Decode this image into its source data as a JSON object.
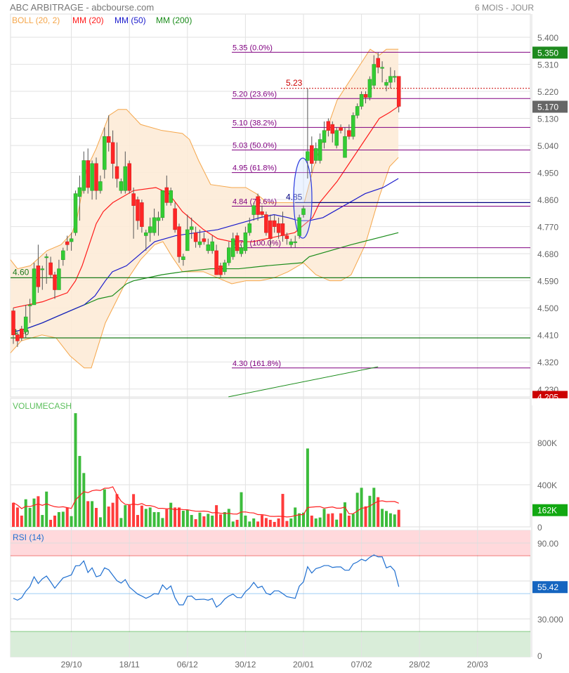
{
  "header": {
    "title": "ABC ARBITRAGE - abcbourse.com",
    "period": "6 MOIS - JOUR"
  },
  "legend": [
    {
      "label": "BOLL (20, 2)",
      "color": "#f5a64a"
    },
    {
      "label": "MM (20)",
      "color": "#ff1a1a"
    },
    {
      "label": "MM (50)",
      "color": "#1a1acc"
    },
    {
      "label": "MM (200)",
      "color": "#1a8c1a"
    }
  ],
  "colors": {
    "up": "#33cc33",
    "down": "#ff2626",
    "fib": "#800080",
    "boll_fill": "#fdebd7",
    "rsi": "#1f6fd0"
  },
  "chart_data": {
    "type": "candlestick",
    "title": "ABC ARBITRAGE",
    "price_ticks": [
      "5.400",
      "5.310",
      "5.220",
      "5.130",
      "5.040",
      "4.950",
      "4.860",
      "4.770",
      "4.680",
      "4.590",
      "4.500",
      "4.410",
      "4.320",
      "4.230"
    ],
    "date_ticks": [
      {
        "index": 14,
        "label": "29/10"
      },
      {
        "index": 28,
        "label": "18/11"
      },
      {
        "index": 42,
        "label": "06/12"
      },
      {
        "index": 56,
        "label": "30/12"
      },
      {
        "index": 70,
        "label": "20/01"
      },
      {
        "index": 84,
        "label": "07/02"
      },
      {
        "index": 98,
        "label": "28/02"
      },
      {
        "index": 112,
        "label": "20/03"
      }
    ],
    "ohlc": [
      [
        4.49,
        4.5,
        4.38,
        4.41
      ],
      [
        4.41,
        4.42,
        4.37,
        4.39
      ],
      [
        4.43,
        4.44,
        4.39,
        4.4
      ],
      [
        4.42,
        4.51,
        4.4,
        4.47
      ],
      [
        4.51,
        4.53,
        4.45,
        4.51
      ],
      [
        4.51,
        4.65,
        4.51,
        4.63
      ],
      [
        4.64,
        4.71,
        4.55,
        4.57
      ],
      [
        4.63,
        4.64,
        4.56,
        4.63
      ],
      [
        4.67,
        4.68,
        4.58,
        4.67
      ],
      [
        4.65,
        4.67,
        4.6,
        4.61
      ],
      [
        4.61,
        4.62,
        4.53,
        4.56
      ],
      [
        4.56,
        4.66,
        4.56,
        4.63
      ],
      [
        4.66,
        4.7,
        4.64,
        4.69
      ],
      [
        4.72,
        4.74,
        4.69,
        4.71
      ],
      [
        4.72,
        4.75,
        4.69,
        4.73
      ],
      [
        4.75,
        4.89,
        4.74,
        4.88
      ],
      [
        4.87,
        4.94,
        4.79,
        4.9
      ],
      [
        4.89,
        5.02,
        4.88,
        4.99
      ],
      [
        4.99,
        5.03,
        4.88,
        4.9
      ],
      [
        4.89,
        4.99,
        4.86,
        4.98
      ],
      [
        4.98,
        5.0,
        4.86,
        4.89
      ],
      [
        4.89,
        4.94,
        4.88,
        4.92
      ],
      [
        4.96,
        5.1,
        4.93,
        5.07
      ],
      [
        5.07,
        5.14,
        5.02,
        5.05
      ],
      [
        5.05,
        5.09,
        4.93,
        4.98
      ],
      [
        4.97,
        5.05,
        4.9,
        4.93
      ],
      [
        4.89,
        4.93,
        4.88,
        4.92
      ],
      [
        4.89,
        5.02,
        4.88,
        4.97
      ],
      [
        4.98,
        4.99,
        4.88,
        4.89
      ],
      [
        4.88,
        4.9,
        4.73,
        4.84
      ],
      [
        4.86,
        4.87,
        4.76,
        4.79
      ],
      [
        4.85,
        4.86,
        4.75,
        4.77
      ],
      [
        4.74,
        4.76,
        4.69,
        4.75
      ],
      [
        4.75,
        4.8,
        4.72,
        4.77
      ],
      [
        4.75,
        4.83,
        4.74,
        4.8
      ],
      [
        4.79,
        4.82,
        4.74,
        4.8
      ],
      [
        4.8,
        4.89,
        4.79,
        4.89
      ],
      [
        4.9,
        4.94,
        4.84,
        4.85
      ],
      [
        4.85,
        4.9,
        4.84,
        4.89
      ],
      [
        4.83,
        4.85,
        4.75,
        4.76
      ],
      [
        4.77,
        4.78,
        4.65,
        4.67
      ],
      [
        4.66,
        4.68,
        4.64,
        4.67
      ],
      [
        4.69,
        4.81,
        4.69,
        4.76
      ],
      [
        4.76,
        4.8,
        4.73,
        4.77
      ],
      [
        4.75,
        4.77,
        4.7,
        4.72
      ],
      [
        4.71,
        4.76,
        4.7,
        4.72
      ],
      [
        4.73,
        4.75,
        4.71,
        4.72
      ],
      [
        4.69,
        4.73,
        4.68,
        4.71
      ],
      [
        4.69,
        4.74,
        4.68,
        4.72
      ],
      [
        4.69,
        4.71,
        4.61,
        4.61
      ],
      [
        4.64,
        4.65,
        4.6,
        4.61
      ],
      [
        4.62,
        4.66,
        4.61,
        4.65
      ],
      [
        4.65,
        4.72,
        4.64,
        4.7
      ],
      [
        4.67,
        4.75,
        4.66,
        4.73
      ],
      [
        4.74,
        4.75,
        4.68,
        4.69
      ],
      [
        4.68,
        4.71,
        4.67,
        4.7
      ],
      [
        4.69,
        4.77,
        4.68,
        4.75
      ],
      [
        4.75,
        4.8,
        4.74,
        4.78
      ],
      [
        4.81,
        4.85,
        4.79,
        4.84
      ],
      [
        4.87,
        4.88,
        4.79,
        4.81
      ],
      [
        4.82,
        4.84,
        4.8,
        4.81
      ],
      [
        4.81,
        4.82,
        4.74,
        4.75
      ],
      [
        4.79,
        4.81,
        4.7,
        4.73
      ],
      [
        4.79,
        4.81,
        4.75,
        4.77
      ],
      [
        4.78,
        4.8,
        4.73,
        4.75
      ],
      [
        4.78,
        4.82,
        4.72,
        4.74
      ],
      [
        4.74,
        4.75,
        4.71,
        4.73
      ],
      [
        4.71,
        4.73,
        4.7,
        4.72
      ],
      [
        4.72,
        4.74,
        4.7,
        4.72
      ],
      [
        4.74,
        4.81,
        4.73,
        4.8
      ],
      [
        4.81,
        4.84,
        4.8,
        4.83
      ],
      [
        4.99,
        5.23,
        4.93,
        5.02
      ],
      [
        5.04,
        5.07,
        4.95,
        4.98
      ],
      [
        4.99,
        5.05,
        4.98,
        5.03
      ],
      [
        4.99,
        5.08,
        4.98,
        5.06
      ],
      [
        5.05,
        5.12,
        5.03,
        5.09
      ],
      [
        5.12,
        5.13,
        5.07,
        5.09
      ],
      [
        5.11,
        5.12,
        5.05,
        5.08
      ],
      [
        5.04,
        5.1,
        5.03,
        5.09
      ],
      [
        5.1,
        5.11,
        5.08,
        5.09
      ],
      [
        5.0,
        5.1,
        5.0,
        5.07
      ],
      [
        5.09,
        5.11,
        5.06,
        5.07
      ],
      [
        5.07,
        5.15,
        5.06,
        5.14
      ],
      [
        5.14,
        5.18,
        5.13,
        5.17
      ],
      [
        5.17,
        5.22,
        5.16,
        5.21
      ],
      [
        5.21,
        5.22,
        5.18,
        5.2
      ],
      [
        5.2,
        5.27,
        5.19,
        5.26
      ],
      [
        5.24,
        5.34,
        5.23,
        5.31
      ],
      [
        5.33,
        5.35,
        5.28,
        5.3
      ],
      [
        5.3,
        5.32,
        5.25,
        5.3
      ],
      [
        5.24,
        5.26,
        5.22,
        5.25
      ],
      [
        5.25,
        5.3,
        5.23,
        5.27
      ],
      [
        5.27,
        5.29,
        5.25,
        5.27
      ],
      [
        5.27,
        5.27,
        5.15,
        5.17
      ]
    ],
    "mm20": [
      [
        0,
        4.5
      ],
      [
        7,
        4.52
      ],
      [
        13,
        4.55
      ],
      [
        15,
        4.59
      ],
      [
        16.6,
        4.64
      ],
      [
        18.3,
        4.71
      ],
      [
        20,
        4.78
      ],
      [
        21.7,
        4.82
      ],
      [
        24,
        4.85
      ],
      [
        29,
        4.89
      ],
      [
        34.4,
        4.9
      ],
      [
        37.5,
        4.88
      ],
      [
        40.8,
        4.82
      ],
      [
        45.9,
        4.76
      ],
      [
        49.3,
        4.73
      ],
      [
        52.7,
        4.72
      ],
      [
        57.8,
        4.72
      ],
      [
        61.2,
        4.73
      ],
      [
        67.9,
        4.75
      ],
      [
        69.6,
        4.77
      ],
      [
        72.2,
        4.8
      ],
      [
        73.9,
        4.85
      ],
      [
        78.1,
        4.92
      ],
      [
        81.5,
        4.99
      ],
      [
        84.9,
        5.06
      ],
      [
        88.3,
        5.13
      ],
      [
        90.8,
        5.15
      ],
      [
        92.9,
        5.17
      ]
    ],
    "mm50": [
      [
        0,
        4.42
      ],
      [
        3,
        4.43
      ],
      [
        7,
        4.45
      ],
      [
        10.3,
        4.47
      ],
      [
        13.7,
        4.49
      ],
      [
        17.1,
        4.51
      ],
      [
        19.7,
        4.54
      ],
      [
        22.2,
        4.59
      ],
      [
        23.9,
        4.62
      ],
      [
        27.3,
        4.64
      ],
      [
        30.7,
        4.68
      ],
      [
        34.1,
        4.72
      ],
      [
        39.2,
        4.74
      ],
      [
        44.2,
        4.75
      ],
      [
        49.3,
        4.76
      ],
      [
        54.4,
        4.78
      ],
      [
        59.5,
        4.8
      ],
      [
        62.9,
        4.81
      ],
      [
        66.3,
        4.8
      ],
      [
        68.8,
        4.79
      ],
      [
        71.4,
        4.79
      ],
      [
        74.7,
        4.8
      ],
      [
        79.8,
        4.84
      ],
      [
        84.9,
        4.88
      ],
      [
        89.2,
        4.9
      ],
      [
        92.9,
        4.93
      ]
    ],
    "mm200": [
      [
        0,
        4.42
      ],
      [
        3,
        4.43
      ],
      [
        7,
        4.45
      ],
      [
        10.3,
        4.47
      ],
      [
        13.7,
        4.49
      ],
      [
        17.1,
        4.51
      ],
      [
        20.5,
        4.53
      ],
      [
        23.9,
        4.54
      ],
      [
        27.3,
        4.58
      ],
      [
        29,
        4.59
      ],
      [
        35.8,
        4.61
      ],
      [
        40.8,
        4.62
      ],
      [
        47.6,
        4.63
      ],
      [
        54.4,
        4.63
      ],
      [
        61.2,
        4.64
      ],
      [
        69.7,
        4.65
      ],
      [
        71.4,
        4.67
      ],
      [
        81.5,
        4.71
      ],
      [
        92.9,
        4.75
      ]
    ],
    "boll_upper": [
      [
        -0.7,
        4.66
      ],
      [
        1,
        4.63
      ],
      [
        4.1,
        4.64
      ],
      [
        8.1,
        4.69
      ],
      [
        11.5,
        4.71
      ],
      [
        14.2,
        4.75
      ],
      [
        15.4,
        4.8
      ],
      [
        17.6,
        4.96
      ],
      [
        20,
        5.03
      ],
      [
        23.1,
        5.14
      ],
      [
        25.3,
        5.16
      ],
      [
        27.3,
        5.16
      ],
      [
        30.7,
        5.11
      ],
      [
        35.8,
        5.09
      ],
      [
        40.8,
        5.08
      ],
      [
        42.5,
        5.06
      ],
      [
        44.7,
        4.99
      ],
      [
        47.6,
        4.91
      ],
      [
        52.7,
        4.9
      ],
      [
        56.1,
        4.9
      ],
      [
        58.6,
        4.88
      ],
      [
        61.2,
        4.85
      ],
      [
        70.2,
        4.85
      ],
      [
        72.5,
        4.97
      ],
      [
        78.1,
        5.19
      ],
      [
        86.1,
        5.36
      ],
      [
        88.3,
        5.34
      ],
      [
        90,
        5.36
      ],
      [
        92.9,
        5.36
      ]
    ],
    "boll_lower": [
      [
        -0.7,
        4.35
      ],
      [
        1.9,
        4.39
      ],
      [
        6.9,
        4.41
      ],
      [
        10.3,
        4.4
      ],
      [
        13.7,
        4.34
      ],
      [
        17.1,
        4.3
      ],
      [
        18.8,
        4.3
      ],
      [
        22.2,
        4.45
      ],
      [
        27.3,
        4.59
      ],
      [
        30.7,
        4.66
      ],
      [
        34.1,
        4.71
      ],
      [
        36.1,
        4.72
      ],
      [
        38.3,
        4.67
      ],
      [
        40.8,
        4.62
      ],
      [
        45.9,
        4.62
      ],
      [
        49.3,
        4.6
      ],
      [
        52.7,
        4.58
      ],
      [
        56.1,
        4.59
      ],
      [
        59.5,
        4.59
      ],
      [
        62.9,
        4.6
      ],
      [
        66.3,
        4.62
      ],
      [
        70,
        4.65
      ],
      [
        73,
        4.61
      ],
      [
        76.4,
        4.59
      ],
      [
        79,
        4.59
      ],
      [
        81.5,
        4.61
      ],
      [
        84.9,
        4.71
      ],
      [
        88.3,
        4.87
      ],
      [
        90.8,
        4.97
      ],
      [
        92.9,
        5.0
      ]
    ],
    "fibonacci": [
      {
        "price": 5.35,
        "label": "5.35  (0.0%)"
      },
      {
        "price": 5.196,
        "label": "5.20  (23.6%)"
      },
      {
        "price": 5.1,
        "label": "5.10  (38.2%)"
      },
      {
        "price": 5.025,
        "label": "5.03  (50.0%)"
      },
      {
        "price": 4.95,
        "label": "4.95  (61.8%)"
      },
      {
        "price": 4.838,
        "label": "4.84  (78.6%)"
      },
      {
        "price": 4.7,
        "label": "4.70  (100.0%)"
      },
      {
        "price": 4.3,
        "label": "4.30  (161.8%)"
      }
    ],
    "levels": [
      {
        "price": 4.6,
        "label": "4.60",
        "color": "#1a7a1a"
      },
      {
        "price": 4.4,
        "label": "4.40",
        "color": "#1a7a1a"
      }
    ],
    "resistance": {
      "price": 5.23,
      "label": "5.23",
      "color": "#cc0000"
    },
    "support": {
      "price": 4.85,
      "label": "4.85",
      "color": "#000080"
    },
    "trendline": [
      [
        51.9,
        4.204
      ],
      [
        88,
        4.304
      ]
    ],
    "last_badges": [
      {
        "value": "5.350",
        "price": 5.35,
        "color": "#1e8a1e"
      },
      {
        "value": "5.170",
        "price": 5.17,
        "color": "#666666"
      },
      {
        "value": "4.205",
        "price": 4.205,
        "color": "#cc0000"
      }
    ],
    "volume": {
      "title": "VOLUMECASH",
      "unit": "K",
      "ticks": [
        {
          "value": 800,
          "label": "800K"
        },
        {
          "value": 400,
          "label": "400K"
        },
        {
          "value": 0,
          "label": "0"
        }
      ],
      "ma_period": 10,
      "last_label": "162K",
      "values": [
        229,
        184,
        107,
        262,
        180,
        269,
        291,
        113,
        335,
        67,
        107,
        140,
        144,
        184,
        102,
        1079,
        673,
        511,
        244,
        244,
        180,
        91,
        357,
        193,
        229,
        311,
        84,
        206,
        206,
        311,
        113,
        202,
        171,
        184,
        140,
        140,
        84,
        167,
        229,
        184,
        184,
        153,
        162,
        113,
        73,
        135,
        100,
        124,
        107,
        206,
        118,
        140,
        171,
        51,
        67,
        329,
        107,
        51,
        80,
        51,
        111,
        84,
        67,
        47,
        80,
        313,
        56,
        80,
        184,
        129,
        135,
        744,
        107,
        80,
        89,
        171,
        124,
        129,
        69,
        129,
        233,
        107,
        124,
        324,
        371,
        195,
        295,
        371,
        282,
        171,
        151,
        129,
        118,
        162
      ]
    },
    "rsi": {
      "title": "RSI (14)",
      "ticks": [
        {
          "value": 90,
          "label": "90.00"
        },
        {
          "value": 30,
          "label": "30.000"
        },
        {
          "value": 0,
          "label": "0"
        }
      ],
      "overbought": 80,
      "oversold": 20,
      "mid": 50,
      "last_label": "55.42",
      "values": [
        46.3,
        44.8,
        46.7,
        51.9,
        55.6,
        63.3,
        58,
        61.7,
        63.9,
        59.3,
        54.3,
        58.5,
        62.4,
        63.6,
        64.8,
        71.9,
        72.2,
        75.9,
        66.7,
        70.4,
        63.3,
        64.3,
        70.4,
        68.9,
        64.5,
        60.2,
        58.3,
        61.1,
        55.2,
        52.4,
        49.6,
        48.1,
        46.3,
        47.8,
        50,
        49.6,
        56.9,
        53.3,
        56.1,
        46.7,
        41.1,
        41.1,
        47.8,
        48.1,
        45.2,
        45.4,
        45.6,
        44.8,
        46.1,
        39.3,
        41.7,
        45.7,
        48.1,
        49.6,
        46.9,
        46.7,
        51.5,
        54.4,
        58.9,
        54.6,
        55.9,
        50.4,
        49.1,
        52.2,
        52.2,
        50,
        47.6,
        46.9,
        46.3,
        55.9,
        59.3,
        71.3,
        66.3,
        69.8,
        70.7,
        72.2,
        72.2,
        70.7,
        71.1,
        71.1,
        68.5,
        68.5,
        73.5,
        75,
        77.2,
        75.9,
        78.7,
        80.6,
        79.1,
        79.1,
        70.4,
        71.7,
        68.1,
        55.42
      ]
    }
  }
}
